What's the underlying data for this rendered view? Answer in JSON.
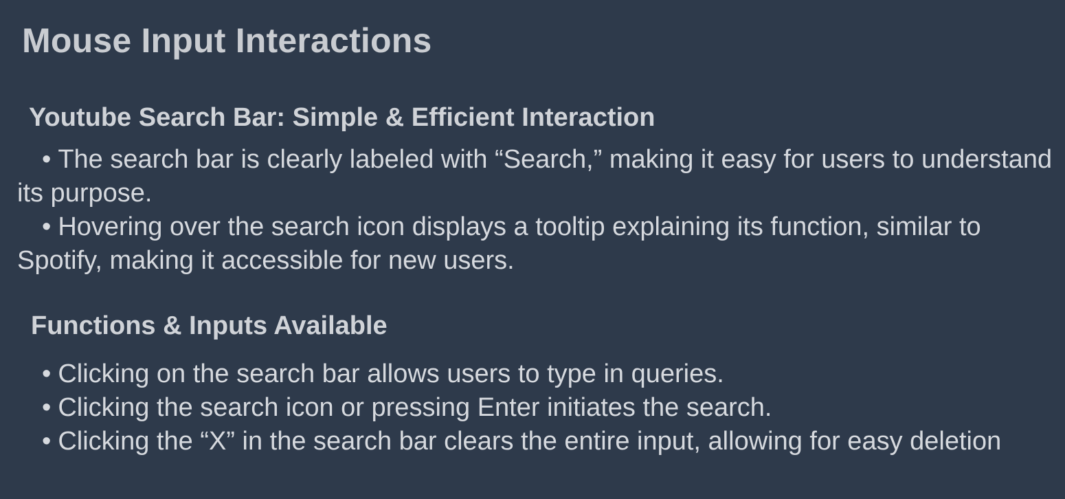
{
  "title": "Mouse Input Interactions",
  "sections": [
    {
      "heading": "Youtube Search Bar: Simple & Efficient Interaction",
      "bullets": [
        "The search bar is clearly labeled with “Search,” making it easy for users to understand its purpose.",
        "Hovering over the search icon displays a tooltip explaining its function, similar to Spotify, making it accessible for new users."
      ]
    },
    {
      "heading": "Functions & Inputs Available",
      "bullets": [
        "Clicking on the search bar allows users to type in queries.",
        "Clicking the search icon or pressing Enter initiates the search.",
        "Clicking the “X” in the search bar clears the entire input, allowing for easy deletion"
      ]
    }
  ],
  "bullet_symbol": "•"
}
